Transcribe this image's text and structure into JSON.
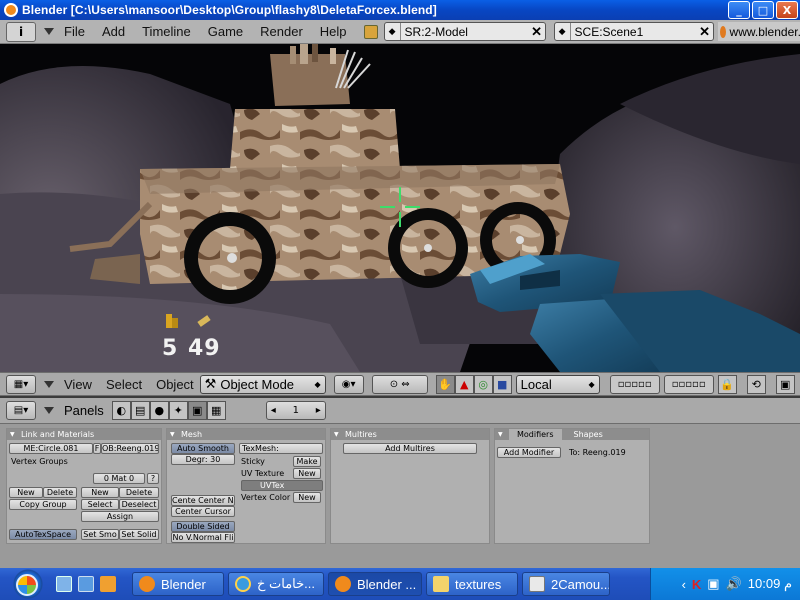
{
  "window": {
    "title": "Blender [C:\\Users\\mansoor\\Desktop\\Group\\flashy8\\DeletaForcex.blend]",
    "controls": [
      "_",
      "□",
      "X"
    ]
  },
  "top_menu": {
    "info_label": "i",
    "items": [
      "File",
      "Add",
      "Timeline",
      "Game",
      "Render",
      "Help"
    ],
    "screen_field": "SR:2-Model",
    "scene_field": "SCE:Scene1",
    "url": "www.blender.or"
  },
  "hud": {
    "ammo_clip": "5",
    "ammo_total": "49"
  },
  "viewport_header": {
    "menus": [
      "View",
      "Select",
      "Object"
    ],
    "mode": "Object Mode",
    "orientation": "Local"
  },
  "buttons_header": {
    "panels_label": "Panels",
    "frame": "1"
  },
  "panels": {
    "link_materials": {
      "title": "Link and Materials",
      "me_field": "ME:Circle.081",
      "f_label": "F",
      "ob_field": "OB:Reeng.019",
      "vertex_groups": "Vertex Groups",
      "mat_field": "0 Mat 0",
      "q": "?",
      "new": "New",
      "delete": "Delete",
      "copy_group": "Copy Group",
      "new2": "New",
      "delete2": "Delete",
      "select": "Select",
      "deselect": "Deselect",
      "assign": "Assign",
      "autotexspace": "AutoTexSpace",
      "set_smo": "Set Smo",
      "set_solid": "Set Solid"
    },
    "mesh": {
      "title": "Mesh",
      "auto_smooth": "Auto Smooth",
      "degr": "Degr: 30",
      "center_new": "Cente Center Ne",
      "center_cursor": "Center Cursor",
      "double_sided": "Double Sided",
      "no_vnormal": "No V.Normal Fli",
      "texmesh": "TexMesh:",
      "sticky": "Sticky",
      "make": "Make",
      "uv_texture": "UV Texture",
      "new_uv": "New",
      "uvtex": "UVTex",
      "vertex_color": "Vertex Color",
      "new_vc": "New"
    },
    "multires": {
      "title": "Multires",
      "add_multires": "Add Multires"
    },
    "modifiers": {
      "tab_modifiers": "Modifiers",
      "tab_shapes": "Shapes",
      "add_modifier": "Add Modifier",
      "to": "To: Reeng.019"
    }
  },
  "taskbar": {
    "tasks": [
      "Blender",
      "خامات خ...",
      "Blender ...",
      "textures",
      "2Camou..."
    ],
    "clock": "10:09 م"
  }
}
